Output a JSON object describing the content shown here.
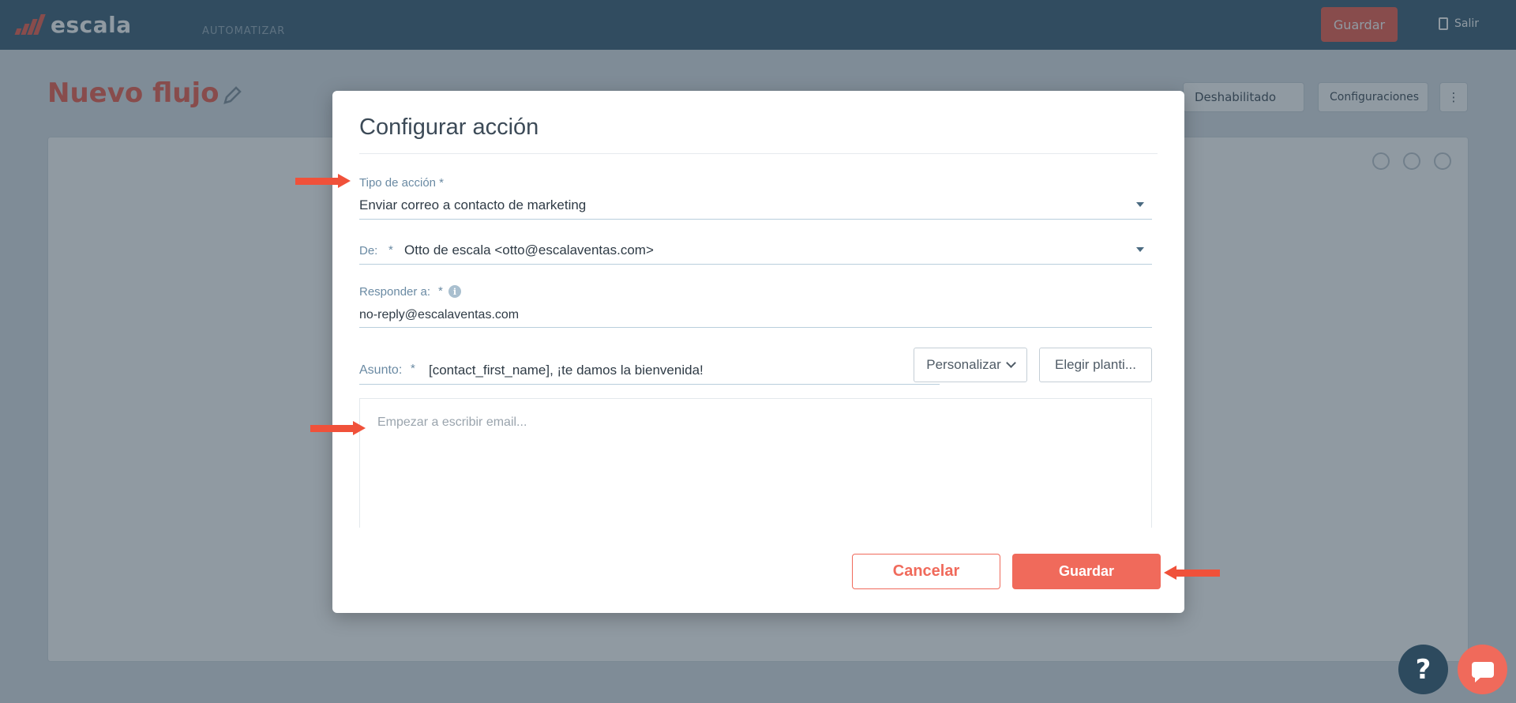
{
  "header": {
    "logo_text": "escala",
    "nav_label": "AUTOMATIZAR",
    "save_label": "Guardar",
    "exit_label": "Salir"
  },
  "page": {
    "title": "Nuevo flujo",
    "status_label": "Deshabilitado",
    "settings_label": "Configuraciones"
  },
  "modal": {
    "title": "Configurar acción",
    "action_type": {
      "label": "Tipo de acción *",
      "value": "Enviar correo a contacto de marketing"
    },
    "from": {
      "label": "De:",
      "required": "*",
      "value": "Otto de escala <otto@escalaventas.com>"
    },
    "reply_to": {
      "label": "Responder a:",
      "required": "*",
      "info_icon": "i",
      "value": "no-reply@escalaventas.com"
    },
    "subject": {
      "label": "Asunto:",
      "required": "*",
      "value": "[contact_first_name], ¡te damos la bienvenida!",
      "personalize_label": "Personalizar",
      "template_label": "Elegir planti..."
    },
    "editor": {
      "placeholder": "Empezar a escribir email..."
    },
    "cancel_label": "Cancelar",
    "save_label": "Guardar"
  },
  "floating": {
    "help_label": "?"
  },
  "colors": {
    "accent": "#f06a5b",
    "header": "#4a6a80",
    "annotation_arrow": "#f0513a"
  },
  "icons": [
    "logo-icon",
    "pencil-icon",
    "exit-icon",
    "chevron-down-icon",
    "info-icon",
    "help-icon",
    "chat-icon",
    "zoom-in-icon",
    "zoom-out-icon",
    "user-icon"
  ]
}
